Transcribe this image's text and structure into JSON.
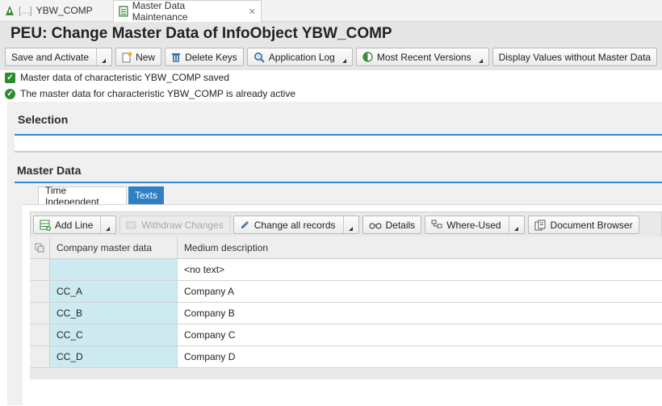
{
  "tabs": [
    {
      "label": "YBW_COMP",
      "blurred_prefix": "[...]"
    },
    {
      "label": "Master Data Maintenance"
    }
  ],
  "title": "PEU: Change Master Data of InfoObject YBW_COMP",
  "toolbar": {
    "save_activate": "Save and Activate",
    "new": "New",
    "delete_keys": "Delete Keys",
    "application_log": "Application Log",
    "most_recent_versions": "Most Recent Versions",
    "display_values": "Display Values without Master Data"
  },
  "messages": [
    "Master data of characteristic YBW_COMP saved",
    "The master data for characteristic YBW_COMP is already active"
  ],
  "sections": {
    "selection": "Selection",
    "master_data": "Master Data"
  },
  "inner_tabs": {
    "time_independent": "Time Independent",
    "texts": "Texts"
  },
  "grid_toolbar": {
    "add_line": "Add Line",
    "withdraw_changes": "Withdraw Changes",
    "change_all": "Change all records",
    "details": "Details",
    "where_used": "Where-Used",
    "document_browser": "Document Browser"
  },
  "table": {
    "columns": [
      "Company master data",
      "Medium description"
    ],
    "rows": [
      {
        "key": "",
        "desc": "<no text>"
      },
      {
        "key": "CC_A",
        "desc": "Company A"
      },
      {
        "key": "CC_B",
        "desc": "Company B"
      },
      {
        "key": "CC_C",
        "desc": "Company C"
      },
      {
        "key": "CC_D",
        "desc": "Company D"
      }
    ]
  },
  "colors": {
    "accent_blue": "#2f7fc4",
    "success_green": "#2e8b2e",
    "key_column": "#cdeaf0"
  }
}
